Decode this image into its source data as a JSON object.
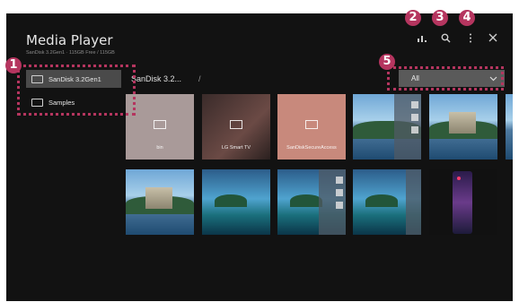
{
  "app": {
    "title": "Media Player",
    "storage_info": "SanDisk 3.2Gen1 · 115GB Free / 115GB"
  },
  "toolbar": {
    "sort_icon": "sort-icon",
    "search_icon": "search-icon",
    "more_icon": "more-vertical-icon",
    "close_icon": "close-icon"
  },
  "sidebar": {
    "items": [
      {
        "label": "SanDisk 3.2Gen1",
        "icon": "usb-drive-icon",
        "active": true
      },
      {
        "label": "Samples",
        "icon": "image-icon",
        "active": false
      }
    ]
  },
  "breadcrumb": {
    "path": "SanDisk 3.2...",
    "separator": "/"
  },
  "filter": {
    "selected": "All"
  },
  "grid": {
    "folders": [
      {
        "name": "bin"
      },
      {
        "name": "LG Smart TV"
      },
      {
        "name": "SanDiskSecureAccess"
      }
    ]
  },
  "callouts": {
    "labels": [
      "1",
      "2",
      "3",
      "4",
      "5"
    ],
    "color": "#b5355f"
  },
  "colors": {
    "background": "#121212",
    "active_item": "#4a4a4a",
    "filter_bg": "#5a5a5a"
  }
}
